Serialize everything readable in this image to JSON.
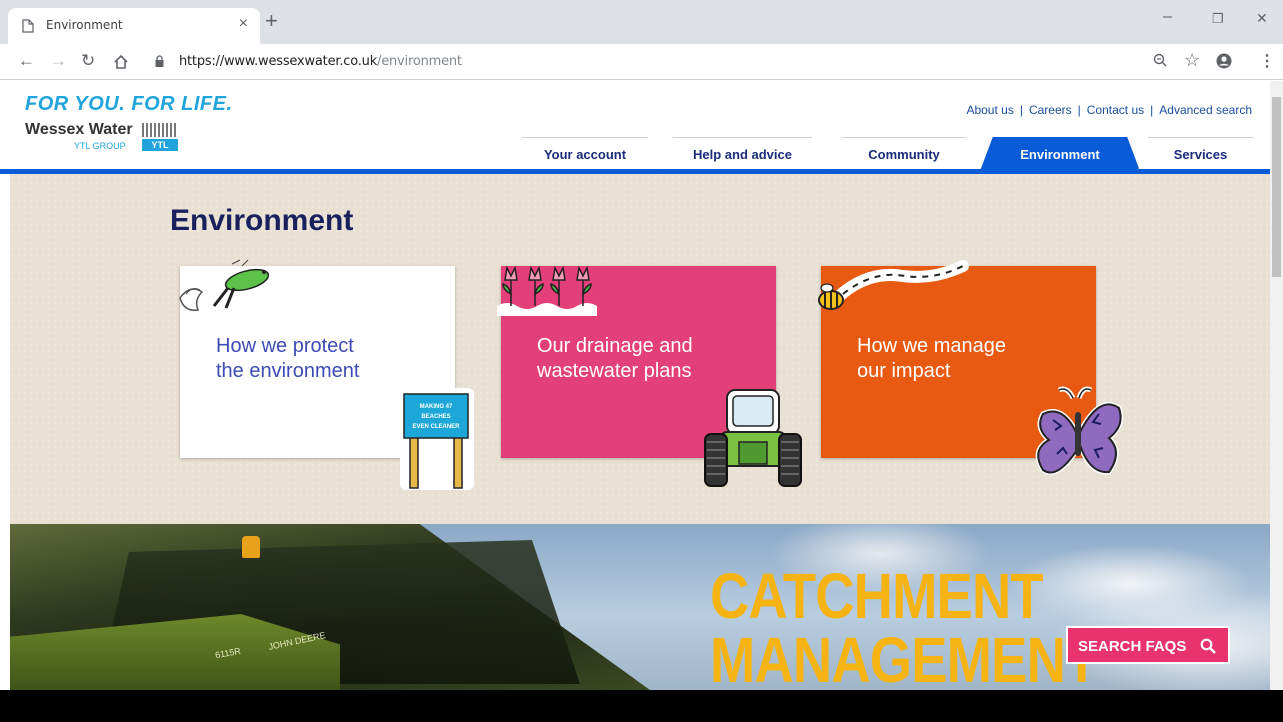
{
  "browser": {
    "tab_title": "Environment",
    "tab_close": "×",
    "new_tab": "+",
    "url_host": "https://www.wessexwater.co.uk",
    "url_path": "/environment",
    "minimize": "–",
    "restore": "❐",
    "close": "✕"
  },
  "site": {
    "slogan": "FOR YOU. FOR LIFE.",
    "brand": "Wessex Water",
    "brand_sub": "YTL GROUP",
    "ytl": "YTL",
    "top_links": [
      "About us",
      "Careers",
      "Contact us",
      "Advanced search"
    ],
    "top_link_sep": "|",
    "nav_tabs": [
      "Your account",
      "Help and advice",
      "Community",
      "Environment",
      "Services"
    ],
    "active_tab": "Environment",
    "accent": "#0a5bd8"
  },
  "main": {
    "title": "Environment",
    "cards": [
      {
        "line1": "How we protect",
        "line2": "the environment",
        "color": "#ffffff"
      },
      {
        "line1": "Our drainage and",
        "line2": "wastewater plans",
        "color": "#e33f78"
      },
      {
        "line1": "How we manage",
        "line2": "our impact",
        "color": "#e85a12"
      }
    ],
    "sign_text": "MAKING 47 BEACHES EVEN CLEANER"
  },
  "banner": {
    "title": "CATCHMENT",
    "title2": "MANAGEMENT",
    "faq_button": "SEARCH FAQS",
    "tractor_model": "6115R",
    "tractor_brand": "JOHN DEERE"
  }
}
